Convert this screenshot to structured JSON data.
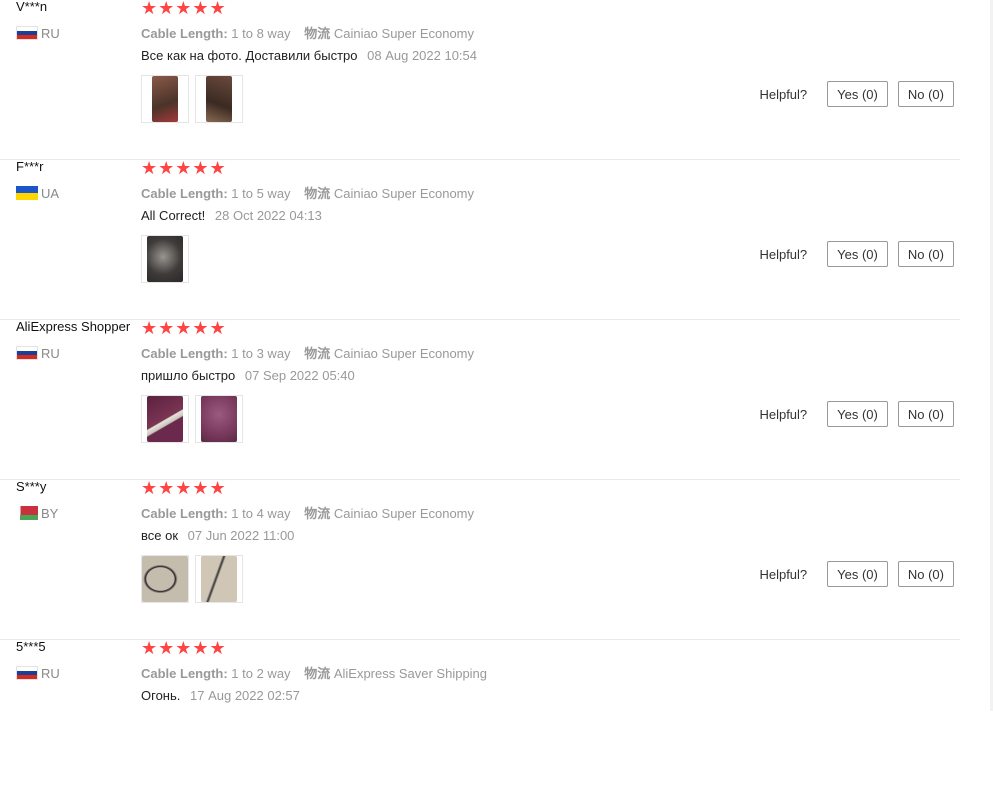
{
  "helpful_label": "Helpful?",
  "attr_cable_key": "Cable Length:",
  "attr_ship_key": "物流",
  "reviews": [
    {
      "user": "V***n",
      "country": "RU",
      "flag": "ru",
      "stars": "★★★★★",
      "cable": "1 to 8 way",
      "shipping": "Cainiao Super Economy",
      "comment": "Все как на фото. Доставили быстро",
      "date": "08 Aug 2022 10:54",
      "yes": "Yes (0)",
      "no": "No (0)",
      "thumb_colors": [
        "#6b4a3d",
        "#4f3c30"
      ]
    },
    {
      "user": "F***r",
      "country": "UA",
      "flag": "ua",
      "stars": "★★★★★",
      "cable": "1 to 5 way",
      "shipping": "Cainiao Super Economy",
      "comment": "All Correct!",
      "date": "28 Oct 2022 04:13",
      "yes": "Yes (0)",
      "no": "No (0)",
      "thumb_colors": [
        "#3f3b3a"
      ]
    },
    {
      "user": "AliExpress Shopper",
      "country": "RU",
      "flag": "ru",
      "stars": "★★★★★",
      "cable": "1 to 3 way",
      "shipping": "Cainiao Super Economy",
      "comment": "пришло быстро",
      "date": "07 Sep 2022 05:40",
      "yes": "Yes (0)",
      "no": "No (0)",
      "thumb_colors": [
        "#6b2a4d",
        "#7a3a5e"
      ]
    },
    {
      "user": "S***y",
      "country": "BY",
      "flag": "by",
      "stars": "★★★★★",
      "cable": "1 to 4 way",
      "shipping": "Cainiao Super Economy",
      "comment": "все ок",
      "date": "07 Jun 2022 11:00",
      "yes": "Yes (0)",
      "no": "No (0)",
      "thumb_colors": [
        "#bcb3a3",
        "#c9c0b1"
      ]
    },
    {
      "user": "5***5",
      "country": "RU",
      "flag": "ru",
      "stars": "★★★★★",
      "cable": "1 to 2 way",
      "shipping": "AliExpress Saver Shipping",
      "comment": "Огонь.",
      "date": "17 Aug 2022 02:57",
      "yes": "",
      "no": "",
      "thumb_colors": []
    }
  ]
}
